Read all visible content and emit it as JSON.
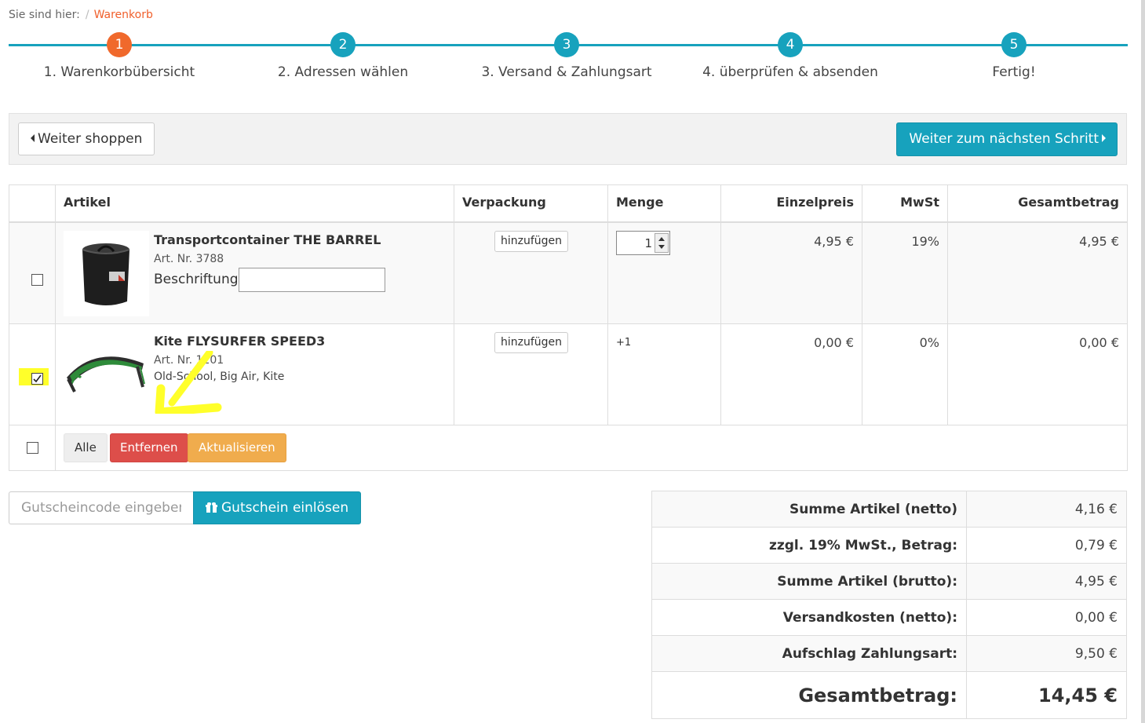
{
  "breadcrumb": {
    "prefix": "Sie sind hier:",
    "separator": "/",
    "current": "Warenkorb"
  },
  "steps": [
    {
      "number": "1",
      "label": "1. Warenkorbübersicht",
      "active": true
    },
    {
      "number": "2",
      "label": "2. Adressen wählen",
      "active": false
    },
    {
      "number": "3",
      "label": "3. Versand & Zahlungsart",
      "active": false
    },
    {
      "number": "4",
      "label": "4. überprüfen & absenden",
      "active": false
    },
    {
      "number": "5",
      "label": "Fertig!",
      "active": false
    }
  ],
  "toolbar": {
    "continue_label": "Weiter shoppen",
    "next_label": "Weiter zum nächsten Schritt"
  },
  "table": {
    "headers": {
      "artikel": "Artikel",
      "verpackung": "Verpackung",
      "menge": "Menge",
      "einzelpreis": "Einzelpreis",
      "mwst": "MwSt",
      "gesamt": "Gesamtbetrag"
    },
    "rows": [
      {
        "checked": false,
        "title": "Transportcontainer THE BARREL",
        "art_nr": "Art. Nr. 3788",
        "beschriftung_label": "Beschriftung",
        "beschriftung_value": "",
        "packaging_button": "hinzufügen",
        "quantity": "1",
        "unit_price": "4,95 €",
        "tax": "19%",
        "total": "4,95 €"
      },
      {
        "checked": true,
        "title": "Kite FLYSURFER SPEED3",
        "art_nr": "Art. Nr. 1201",
        "description": "Old-School, Big Air, Kite",
        "packaging_button": "hinzufügen",
        "quantity": "+1",
        "unit_price": "0,00 €",
        "tax": "0%",
        "total": "0,00 €"
      }
    ],
    "actions": {
      "all": "Alle",
      "remove": "Entfernen",
      "update": "Aktualisieren"
    }
  },
  "voucher": {
    "placeholder": "Gutscheincode eingeben",
    "button": "Gutschein einlösen"
  },
  "summary": [
    {
      "label": "Summe Artikel (netto)",
      "value": "4,16 €"
    },
    {
      "label": "zzgl. 19% MwSt., Betrag:",
      "value": "0,79 €"
    },
    {
      "label": "Summe Artikel (brutto):",
      "value": "4,95 €"
    },
    {
      "label": "Versandkosten (netto):",
      "value": "0,00 €"
    },
    {
      "label": "Aufschlag Zahlungsart:",
      "value": "9,50 €"
    }
  ],
  "grand_total": {
    "label": "Gesamtbetrag:",
    "value": "14,45 €"
  },
  "colors": {
    "accent": "#17a2bd",
    "active_step": "#f0692c",
    "danger": "#dd4e4a",
    "warning": "#f0ac4d",
    "highlight": "#ffff2a"
  }
}
